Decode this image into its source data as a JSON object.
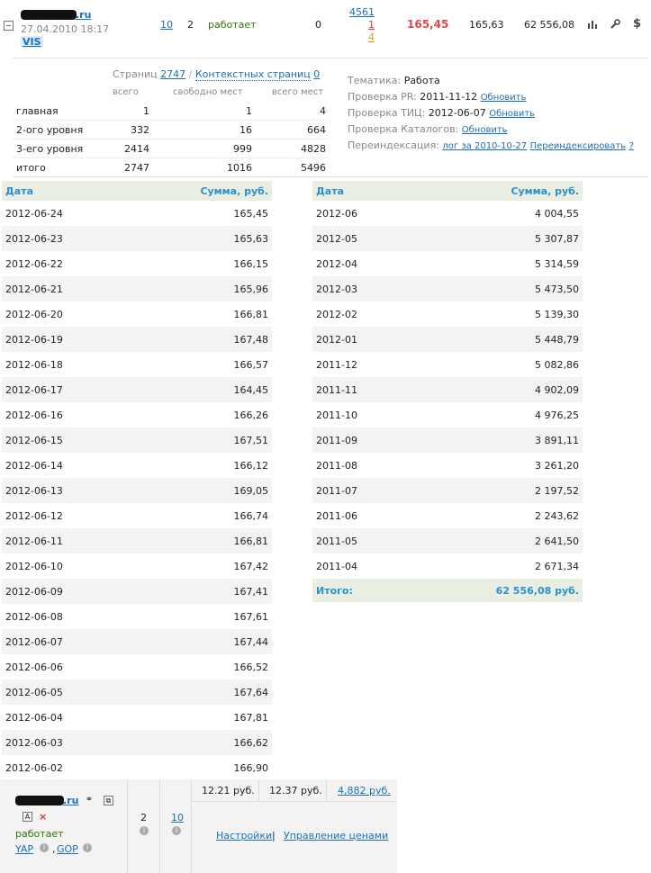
{
  "site": {
    "domain_suffix": ".ru",
    "added": "27.04.2010 18:17",
    "badge": "VIS",
    "pages": "10",
    "levels": "2",
    "status": "работает",
    "zero": "0",
    "links_total": "4561",
    "links_red": "1",
    "links_orange": "4",
    "today": "165,45",
    "yesterday": "165,63",
    "total": "62 556,08"
  },
  "details": {
    "pages_label": "Страниц",
    "pages_value": "2747",
    "context_label": "Контекстных страниц",
    "context_value": "0",
    "col_total": "всего",
    "col_free": "свободно мест",
    "col_places": "всего мест",
    "rows": [
      {
        "label": "главная",
        "a": "1",
        "b": "1",
        "c": "4"
      },
      {
        "label": "2-ого уровня",
        "a": "332",
        "b": "16",
        "c": "664"
      },
      {
        "label": "3-его уровня",
        "a": "2414",
        "b": "999",
        "c": "4828"
      },
      {
        "label": "итого",
        "a": "2747",
        "b": "1016",
        "c": "5496"
      }
    ],
    "theme_label": "Тематика:",
    "theme_value": "Работа",
    "pr_label": "Проверка PR:",
    "pr_date": "2011-11-12",
    "tic_label": "Проверка ТИЦ:",
    "tic_date": "2012-06-07",
    "catalog_label": "Проверка Каталогов:",
    "update": "Обновить",
    "reindex_label": "Переиндексация:",
    "reindex_log": "лог за 2010-10-27",
    "reindex_action": "Переиндексировать",
    "question": "?"
  },
  "daily": {
    "col_date": "Дата",
    "col_sum": "Сумма, руб.",
    "rows": [
      [
        "2012-06-24",
        "165,45"
      ],
      [
        "2012-06-23",
        "165,63"
      ],
      [
        "2012-06-22",
        "166,15"
      ],
      [
        "2012-06-21",
        "165,96"
      ],
      [
        "2012-06-20",
        "166,81"
      ],
      [
        "2012-06-19",
        "167,48"
      ],
      [
        "2012-06-18",
        "166,57"
      ],
      [
        "2012-06-17",
        "164,45"
      ],
      [
        "2012-06-16",
        "166,26"
      ],
      [
        "2012-06-15",
        "167,51"
      ],
      [
        "2012-06-14",
        "166,12"
      ],
      [
        "2012-06-13",
        "169,05"
      ],
      [
        "2012-06-12",
        "166,74"
      ],
      [
        "2012-06-11",
        "166,81"
      ],
      [
        "2012-06-10",
        "167,42"
      ],
      [
        "2012-06-09",
        "167,41"
      ],
      [
        "2012-06-08",
        "167,61"
      ],
      [
        "2012-06-07",
        "167,44"
      ],
      [
        "2012-06-06",
        "166,52"
      ],
      [
        "2012-06-05",
        "167,64"
      ],
      [
        "2012-06-04",
        "167,81"
      ],
      [
        "2012-06-03",
        "166,62"
      ],
      [
        "2012-06-02",
        "166,90"
      ]
    ]
  },
  "monthly": {
    "col_date": "Дата",
    "col_sum": "Сумма, руб.",
    "rows": [
      [
        "2012-06",
        "4 004,55"
      ],
      [
        "2012-05",
        "5 307,87"
      ],
      [
        "2012-04",
        "5 314,59"
      ],
      [
        "2012-03",
        "5 473,50"
      ],
      [
        "2012-02",
        "5 139,30"
      ],
      [
        "2012-01",
        "5 448,79"
      ],
      [
        "2011-12",
        "5 082,86"
      ],
      [
        "2011-11",
        "4 902,09"
      ],
      [
        "2011-10",
        "4 976,25"
      ],
      [
        "2011-09",
        "3 891,11"
      ],
      [
        "2011-08",
        "3 261,20"
      ],
      [
        "2011-07",
        "2 197,52"
      ],
      [
        "2011-06",
        "2 243,62"
      ],
      [
        "2011-05",
        "2 641,50"
      ],
      [
        "2011-04",
        "2 671,34"
      ]
    ],
    "total_label": "Итого:",
    "total_value": "62 556,08 руб."
  },
  "bottom": {
    "domain_suffix": ".ru",
    "status": "работает",
    "yap": "YAP",
    "comma": ",",
    "gop": "GOP",
    "col1": "2",
    "col2": "10",
    "price1": "12.21 руб.",
    "price2": "12.37 руб.",
    "price3": "4,882 руб.",
    "settings": "Настройки",
    "separator": "|",
    "manage": "Управление ценами"
  }
}
